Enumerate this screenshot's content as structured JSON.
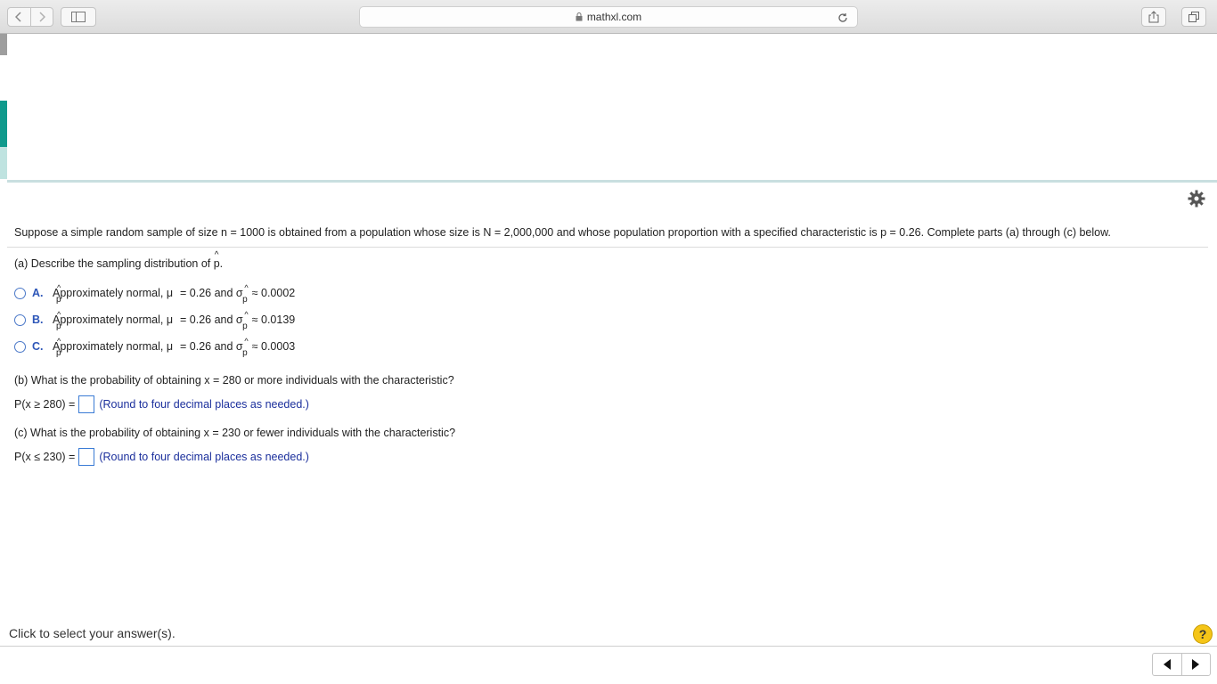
{
  "browser": {
    "url": "mathxl.com"
  },
  "question": {
    "intro": "Suppose a simple random sample of size n = 1000 is obtained from a population whose size is N = 2,000,000 and whose population proportion with a specified characteristic is p = 0.26. Complete parts (a) through (c) below.",
    "part_a": {
      "label_prefix": "(a) Describe the sampling distribution of ",
      "label_var": "p",
      "label_suffix": ".",
      "options": [
        {
          "letter": "A.",
          "text": "Approximately normal, μ",
          "mean": "= 0.26 and σ",
          "sd": "≈ 0.0002"
        },
        {
          "letter": "B.",
          "text": "Approximately normal, μ",
          "mean": "= 0.26 and σ",
          "sd": "≈ 0.0139"
        },
        {
          "letter": "C.",
          "text": "Approximately normal, μ",
          "mean": "= 0.26 and σ",
          "sd": "≈ 0.0003"
        }
      ]
    },
    "part_b": {
      "label": "(b) What is the probability of obtaining x = 280 or more individuals with the characteristic?",
      "prompt": "P(x ≥ 280) =",
      "value": "",
      "hint": "(Round to four decimal places as needed.)"
    },
    "part_c": {
      "label": "(c) What is the probability of obtaining x = 230 or fewer individuals with the characteristic?",
      "prompt": "P(x ≤ 230) =",
      "value": "",
      "hint": "(Round to four decimal places as needed.)"
    }
  },
  "footer": {
    "status": "Click to select your answer(s).",
    "help_label": "?"
  },
  "icons": {
    "sub_p": "p",
    "hat": "^"
  }
}
